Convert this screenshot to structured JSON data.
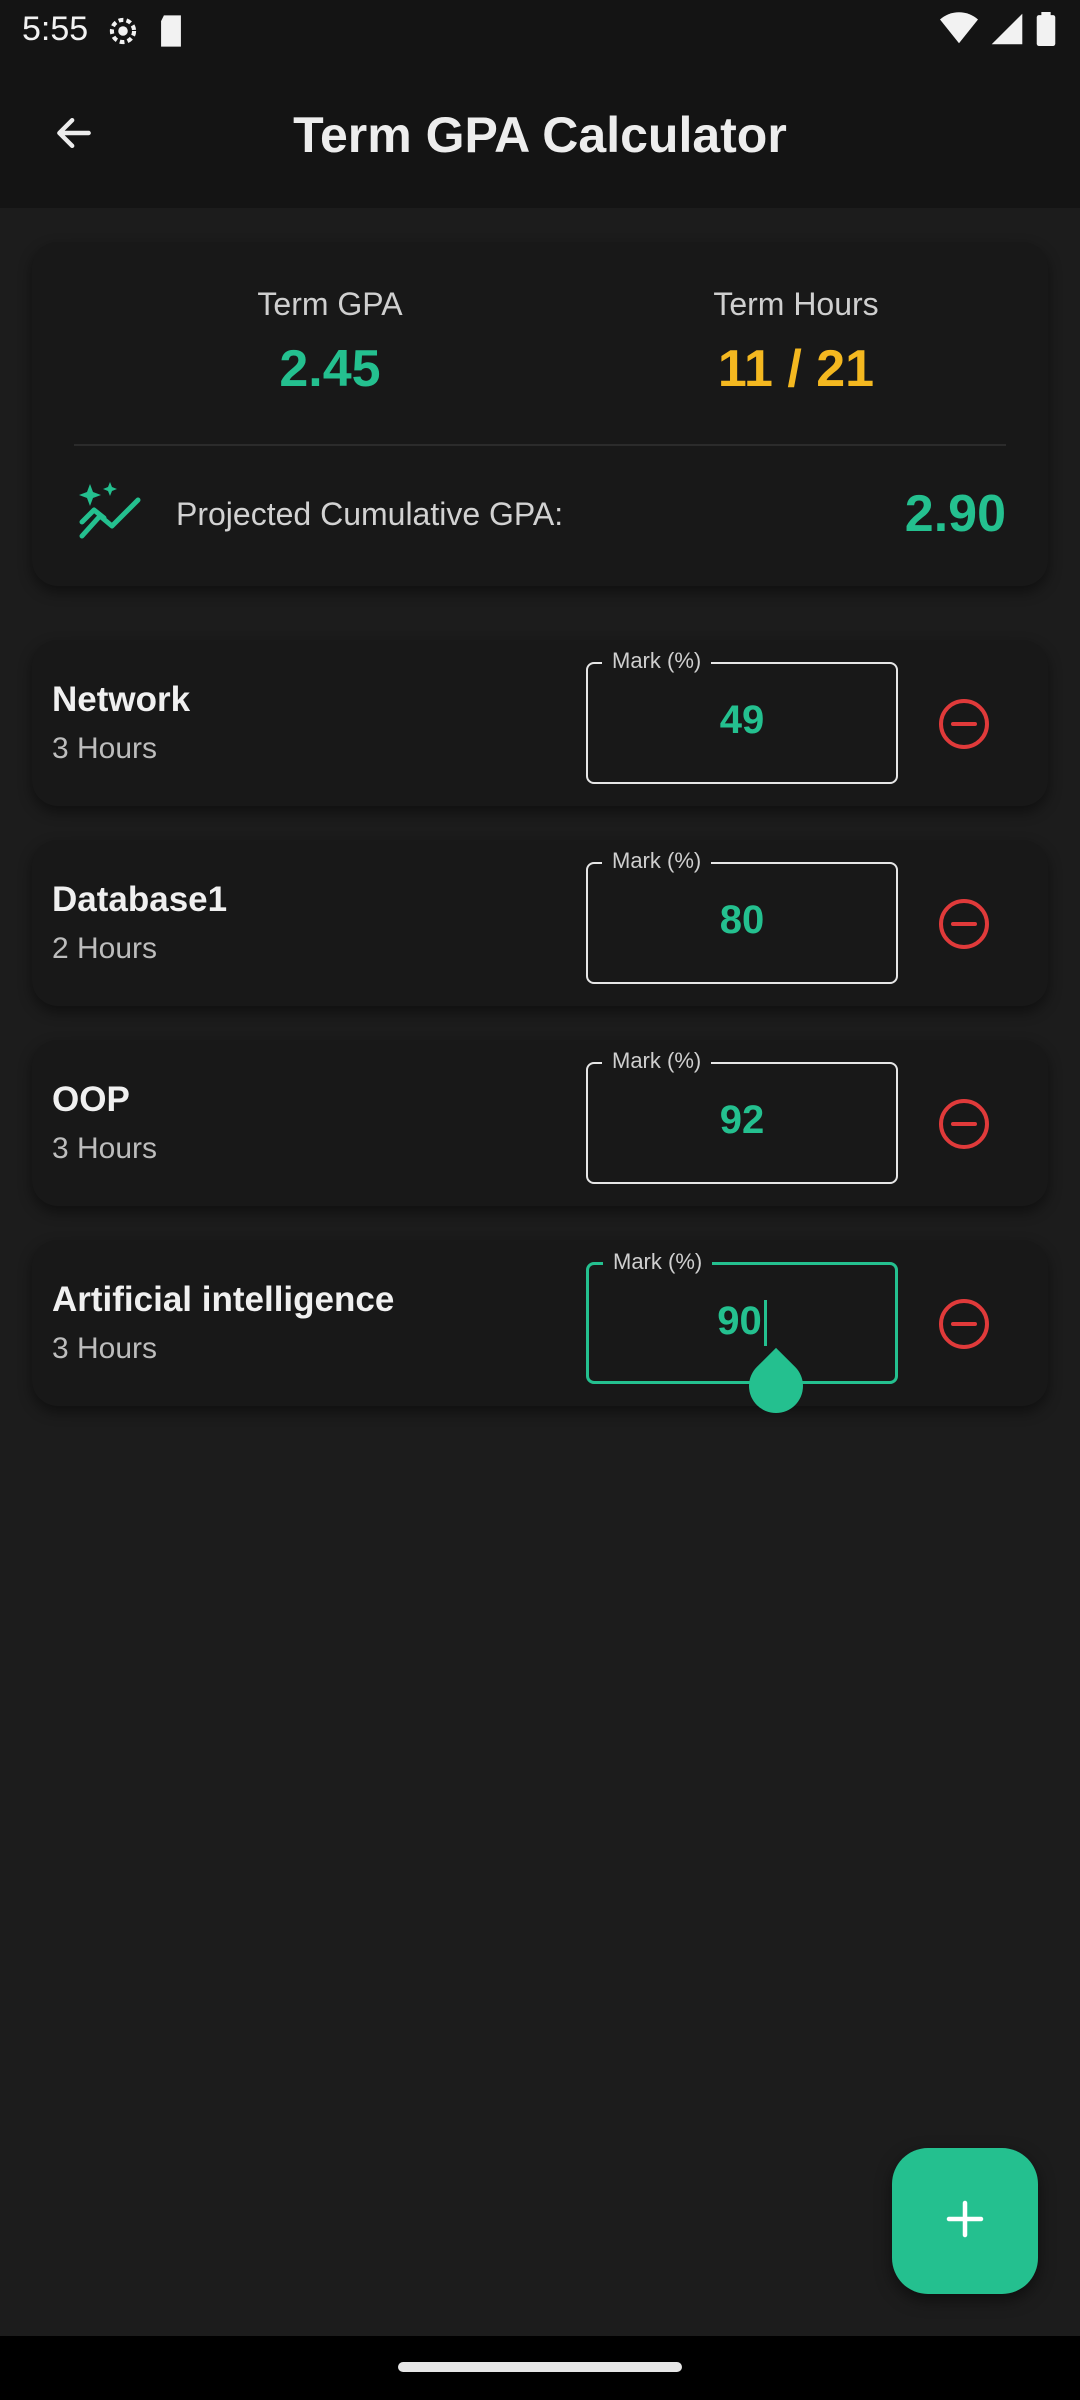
{
  "status_bar": {
    "time": "5:55",
    "icons": [
      "settings-gear-icon",
      "sd-card-icon",
      "wifi-icon",
      "cellular-signal-icon",
      "battery-icon"
    ]
  },
  "app_bar": {
    "title": "Term GPA Calculator",
    "back_icon": "arrow-back-icon"
  },
  "summary": {
    "term_gpa_label": "Term GPA",
    "term_gpa_value": "2.45",
    "term_hours_label": "Term Hours",
    "term_hours_value": "11 / 21",
    "projected_label": "Projected Cumulative GPA:",
    "projected_value": "2.90",
    "projected_icon": "sparkle-trend-icon"
  },
  "courses": [
    {
      "name": "Network",
      "hours": "3 Hours",
      "mark_label": "Mark (%)",
      "mark": "49"
    },
    {
      "name": "Database1",
      "hours": "2 Hours",
      "mark_label": "Mark (%)",
      "mark": "80"
    },
    {
      "name": "OOP",
      "hours": "3 Hours",
      "mark_label": "Mark (%)",
      "mark": "92"
    },
    {
      "name": "Artificial intelligence",
      "hours": "3 Hours",
      "mark_label": "Mark (%)",
      "mark": "90"
    }
  ],
  "fab": {
    "icon": "plus-icon"
  },
  "colors": {
    "accent_green": "#24c08f",
    "accent_yellow": "#f4b820",
    "remove_red": "#e03a3a",
    "background": "#1c1c1c"
  }
}
